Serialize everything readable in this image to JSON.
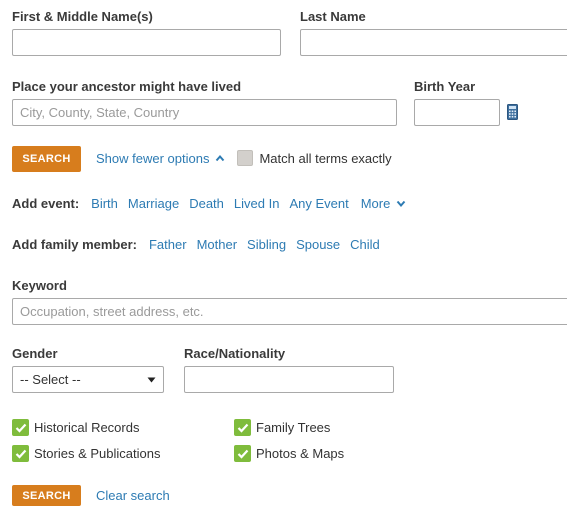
{
  "name": {
    "first_label": "First & Middle Name(s)",
    "last_label": "Last Name",
    "first_value": "",
    "last_value": ""
  },
  "place": {
    "label": "Place your ancestor might have lived",
    "placeholder": "City, County, State, Country",
    "value": ""
  },
  "birth_year": {
    "label": "Birth Year",
    "value": "",
    "icon": "calculator-icon"
  },
  "options": {
    "search_label": "SEARCH",
    "toggle_label": "Show fewer options",
    "toggle_icon": "chevron-up-icon",
    "match_label": "Match all terms exactly",
    "match_checked": false
  },
  "add_event": {
    "label": "Add event:",
    "items": [
      "Birth",
      "Marriage",
      "Death",
      "Lived In",
      "Any Event"
    ],
    "more_label": "More",
    "more_icon": "chevron-down-icon"
  },
  "add_family": {
    "label": "Add family member:",
    "items": [
      "Father",
      "Mother",
      "Sibling",
      "Spouse",
      "Child"
    ]
  },
  "keyword": {
    "label": "Keyword",
    "placeholder": "Occupation, street address, etc.",
    "value": ""
  },
  "gender": {
    "label": "Gender",
    "selected": "-- Select --"
  },
  "race": {
    "label": "Race/Nationality",
    "value": ""
  },
  "collections": [
    {
      "label": "Historical Records",
      "checked": true
    },
    {
      "label": "Family Trees",
      "checked": true
    },
    {
      "label": "Stories & Publications",
      "checked": true
    },
    {
      "label": "Photos & Maps",
      "checked": true
    }
  ],
  "footer": {
    "search_label": "SEARCH",
    "clear_label": "Clear search"
  },
  "colors": {
    "accent": "#d77d1d",
    "link": "#2d7bb3",
    "check": "#7fbc3c"
  }
}
